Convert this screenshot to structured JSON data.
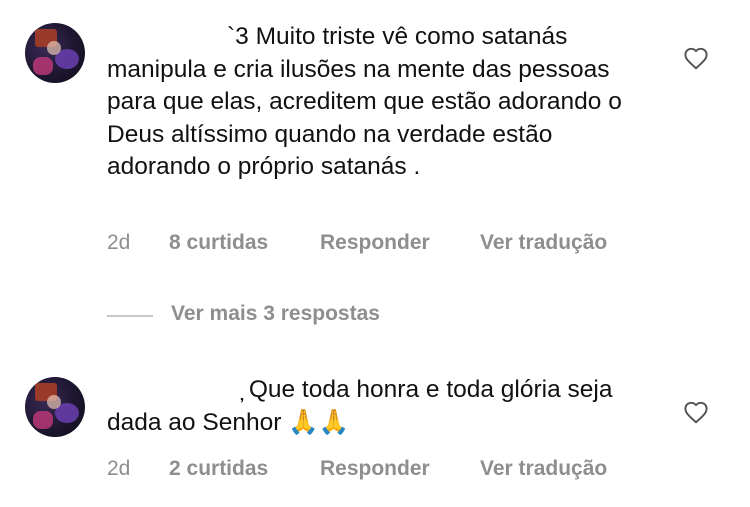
{
  "comments": [
    {
      "username": "`3",
      "text": "Muito triste vê como satanás manipula e cria ilusões na mente das pessoas para que elas, acreditem que estão adorando o Deus altíssimo quando na verdade estão adorando o próprio satanás .",
      "time": "2d",
      "likes": "8 curtidas",
      "reply": "Responder",
      "translate": "Ver tradução"
    },
    {
      "username": "̦",
      "text": "Que toda honra e toda glória seja dada ao Senhor 🙏🙏",
      "time": "2d",
      "likes": "2 curtidas",
      "reply": "Responder",
      "translate": "Ver tradução"
    }
  ],
  "view_more_replies": "Ver mais 3 respostas",
  "icons": {
    "like": "heart-outline-icon"
  }
}
